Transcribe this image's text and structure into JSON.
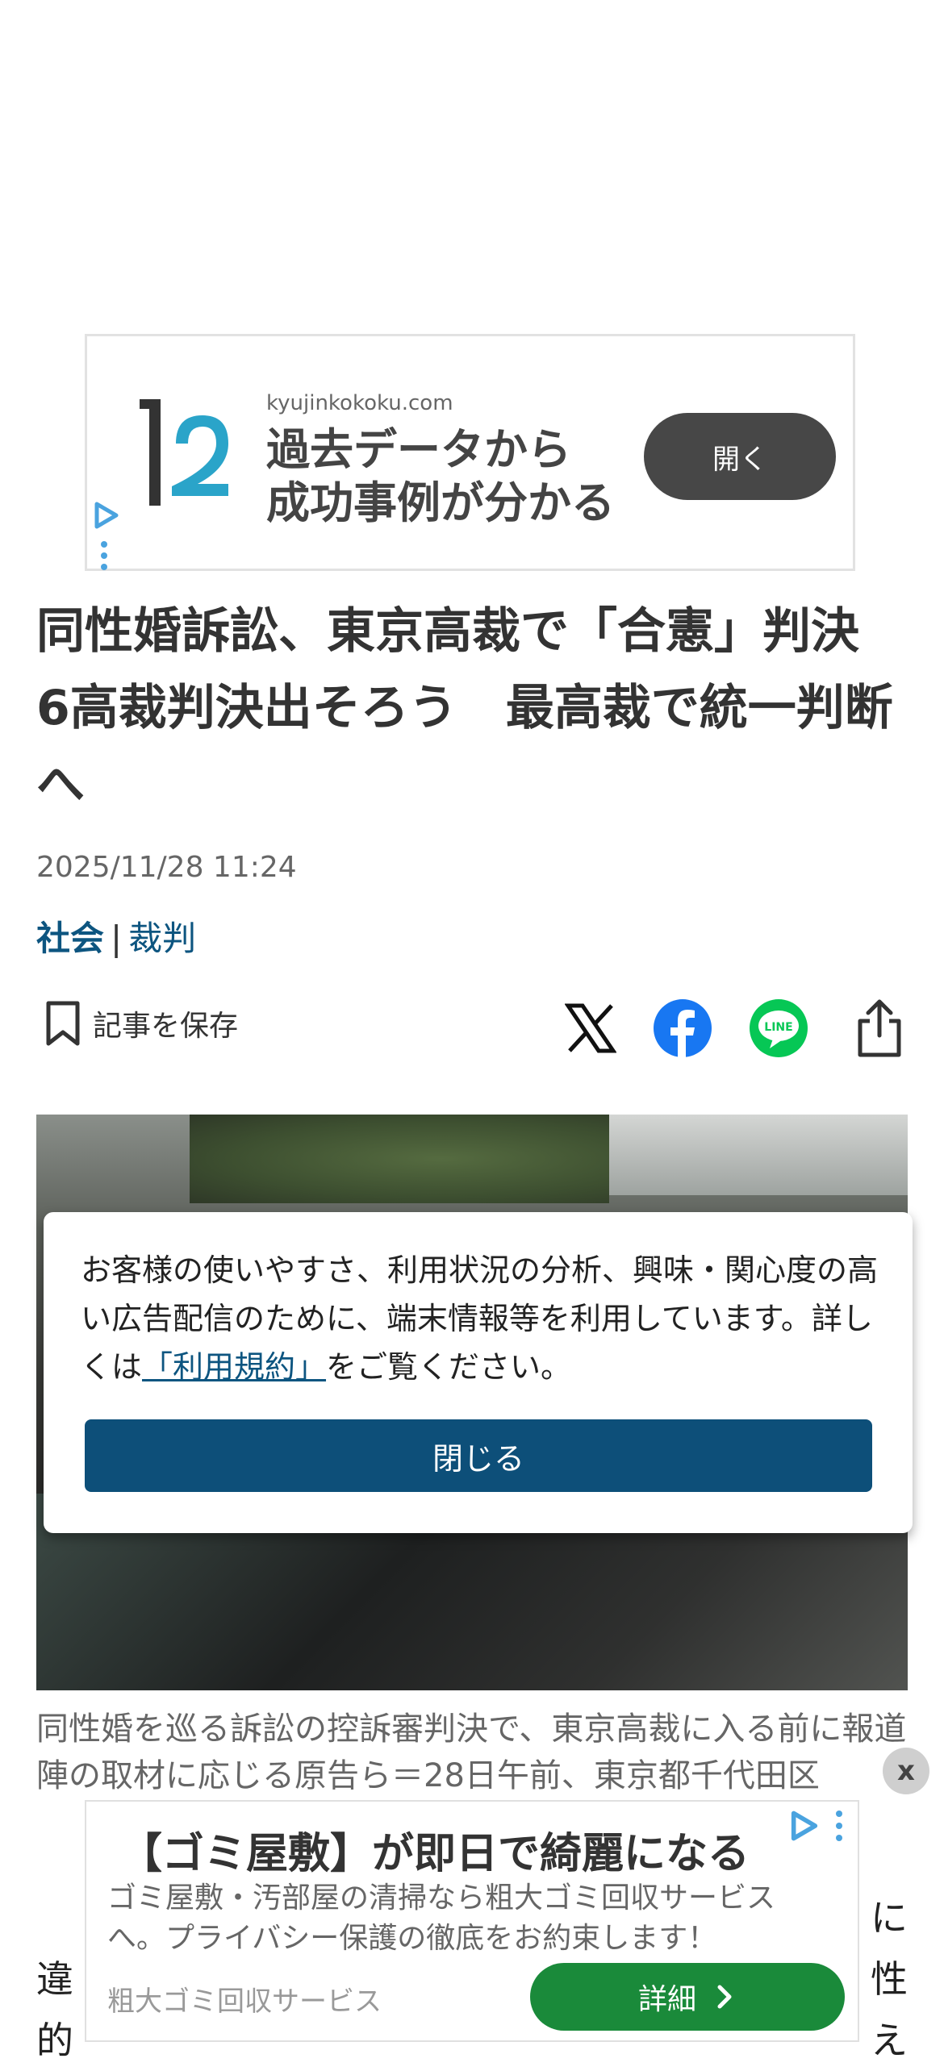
{
  "ad_top": {
    "domain": "kyujinkokoku.com",
    "headline_line1": "過去データから",
    "headline_line2": "成功事例が分かる",
    "cta": "開く",
    "icons": [
      "ad-logo",
      "adchoices-icon",
      "more-vertical-icon"
    ]
  },
  "article": {
    "title": "同性婚訴訟、東京高裁で「合憲」判決　6高裁判決出そろう　最高裁で統一判断へ",
    "date": "2025/11/28 11:24",
    "category_primary": "社会",
    "category_separator": "|",
    "category_secondary": "裁判",
    "save_label": "記事を保存",
    "photo_caption": "同性婚を巡る訴訟の控訴審判決で、東京高裁に入る前に報道陣の取材に応じる原告ら＝28日午前、東京都千代田区",
    "body_line1_start": "「",
    "body_line1_end": "に",
    "body_line2_start": "違",
    "body_line2_end": "性",
    "body_line3_start": "的",
    "body_line3_end": "え"
  },
  "share_icons": [
    "x-icon",
    "facebook-icon",
    "line-icon",
    "share-icon"
  ],
  "share_labels": {
    "line": "LINE"
  },
  "consent": {
    "text_before": "お客様の使いやすさ、利用状況の分析、興味・関心度の高い広告配信のために、端末情報等を利用しています。詳しくは",
    "link": "「利用規約」",
    "text_after": "をご覧ください。",
    "button": "閉じる"
  },
  "ad_bottom": {
    "close": "x",
    "title": "【ゴミ屋敷】が即日で綺麗になる",
    "description": "ゴミ屋敷・汚部屋の清掃なら粗大ゴミ回収サービスへ。プライバシー保護の徹底をお約束します！",
    "brand": "粗大ゴミ回収サービス",
    "cta": "詳細"
  },
  "colors": {
    "link_blue": "#0d5580",
    "consent_button": "#0d4f79",
    "ad_open_button": "#474747",
    "ad_detail_button": "#1a8a3a",
    "facebook": "#1877f2",
    "line": "#06c755",
    "adchoices": "#4aa3df"
  }
}
